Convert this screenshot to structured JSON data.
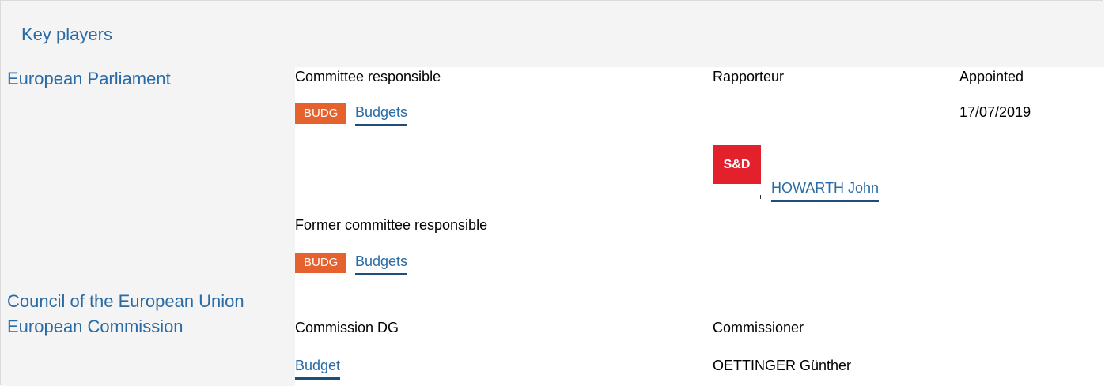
{
  "header": {
    "title": "Key players"
  },
  "institutions": {
    "parliament": "European Parliament",
    "council": "Council of the European Union",
    "commission": "European Commission"
  },
  "parliament": {
    "committee_label": "Committee responsible",
    "rapporteur_label": "Rapporteur",
    "appointed_label": "Appointed",
    "committee": {
      "badge": "BUDG",
      "name": "Budgets"
    },
    "appointed_date": "17/07/2019",
    "rapporteur": {
      "group_logo_text": "S&D",
      "name": "HOWARTH John"
    },
    "former_label": "Former committee responsible",
    "former_committee": {
      "badge": "BUDG",
      "name": "Budgets"
    }
  },
  "commission": {
    "dg_label": "Commission DG",
    "commissioner_label": "Commissioner",
    "dg": "Budget",
    "commissioner": "OETTINGER Günther"
  },
  "colors": {
    "link": "#2a6ba6",
    "badge": "#e5612e",
    "sd_logo": "#e3212d",
    "panel": "#f4f4f4"
  }
}
